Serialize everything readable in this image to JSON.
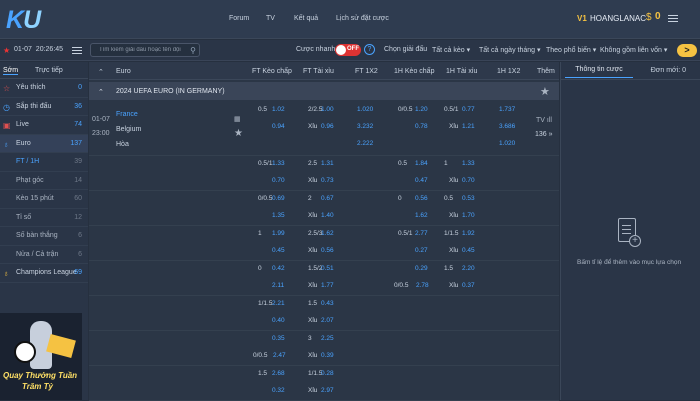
{
  "app": {
    "logo": "KU",
    "logo_colored": "K"
  },
  "topnav": {
    "items": [
      "Forum",
      "TV",
      "Kết quả",
      "Lịch sử đặt cược"
    ],
    "vip": "V1",
    "username": "HOANGLANAC",
    "currency": "$",
    "balance": "0"
  },
  "toolbar": {
    "date": "01-07",
    "time": "20:26:45",
    "search_placeholder": "Tìm kiếm giải đấu hoặc tên đội",
    "quick_bet_label": "Cược nhanh",
    "quick_bet_state": "OFF",
    "select_league": "Chọn giải đấu",
    "all_bet_types": "Tất cả kèo",
    "all_dates": "Tất cả ngày tháng",
    "sort_popular": "Theo phổ biến",
    "no_parlay": "Không gồm liên vốn",
    "more_button": ">"
  },
  "sidebar": {
    "tabs": [
      "Sớm",
      "Trực tiếp"
    ],
    "items": [
      {
        "icon": "star-icon",
        "label": "Yêu thích",
        "count": "0"
      },
      {
        "icon": "clock-icon",
        "label": "Sắp thi đấu",
        "count": "36"
      },
      {
        "icon": "live-icon",
        "label": "Live",
        "count": "74"
      },
      {
        "icon": "trophy-icon",
        "label": "Euro",
        "count": "137"
      },
      {
        "icon": "",
        "label": "FT / 1H",
        "count": "39"
      },
      {
        "icon": "",
        "label": "Phạt góc",
        "count": "14"
      },
      {
        "icon": "",
        "label": "Kèo 15 phút",
        "count": "60"
      },
      {
        "icon": "",
        "label": "Tỉ số",
        "count": "12"
      },
      {
        "icon": "",
        "label": "Số bàn thắng",
        "count": "6"
      },
      {
        "icon": "",
        "label": "Nửa / Cả trận",
        "count": "6"
      },
      {
        "icon": "trophy-icon",
        "label": "Champions League",
        "count": "69"
      }
    ],
    "promo_line1": "Quay Thưởng Tuần",
    "promo_line2": "Trăm Tỷ"
  },
  "table": {
    "headers": [
      "Euro",
      "FT Kèo chấp",
      "FT Tài xỉu",
      "FT 1X2",
      "1H Kèo chấp",
      "1H Tài xỉu",
      "1H 1X2",
      "Thêm"
    ],
    "league": "2024 UEFA EURO (IN GERMANY)",
    "match": {
      "date": "01-07",
      "time": "23:00",
      "home": "France",
      "away": "Belgium",
      "draw": "Hòa",
      "more_count": "136",
      "more_arrow": "»",
      "tv": "TV"
    },
    "rows": [
      {
        "hc": "0.5",
        "hco1": "1.02",
        "hco2": "0.94",
        "ou": "2/2.5",
        "ouo1": "1.00",
        "ouu": "Xỉu",
        "ouo2": "0.96",
        "x1": "1.020",
        "x2": "3.232",
        "x3": "2.222",
        "h_hc": "0/0.5",
        "h_hco1": "1.20",
        "h_hco2": "0.78",
        "h_ou": "0.5/1",
        "h_ouo1": "0.77",
        "h_ouu": "Xỉu",
        "h_ouo2": "1.21",
        "h_x1": "1.737",
        "h_x2": "3.686",
        "h_x3": "1.020"
      },
      {
        "hc": "0.5/1",
        "hco1": "1.33",
        "hco2": "0.70",
        "ou": "2.5",
        "ouo1": "1.31",
        "ouu": "Xỉu",
        "ouo2": "0.73",
        "h_hc": "0.5",
        "h_hco1": "1.84",
        "h_hco2": "0.47",
        "h_ou": "1",
        "h_ouo1": "1.33",
        "h_ouu": "Xỉu",
        "h_ouo2": "0.70"
      },
      {
        "hc": "0/0.5",
        "hco1": "0.69",
        "hco2": "1.35",
        "ou": "2",
        "ouo1": "0.67",
        "ouu": "Xỉu",
        "ouo2": "1.40",
        "h_hc": "0",
        "h_hco1": "0.56",
        "h_hco2": "1.62",
        "h_ou": "0.5",
        "h_ouo1": "0.53",
        "h_ouu": "Xỉu",
        "h_ouo2": "1.70"
      },
      {
        "hc": "1",
        "hco1": "1.99",
        "hco2": "0.45",
        "ou": "2.5/3",
        "ouo1": "1.62",
        "ouu": "Xỉu",
        "ouo2": "0.56",
        "h_hc": "0.5/1",
        "h_hco1": "2.77",
        "h_hco2": "0.27",
        "h_ou": "1/1.5",
        "h_ouo1": "1.92",
        "h_ouu": "Xỉu",
        "h_ouo2": "0.45"
      },
      {
        "hc": "0",
        "hco1": "0.42",
        "hco2": "2.11",
        "ou": "1.5/2",
        "ouo1": "0.51",
        "ouu": "Xỉu",
        "ouo2": "1.77",
        "h_hc": "",
        "h_hco1": "0.29",
        "h_hco2": "0/0.5",
        "h_hco2b": "2.78",
        "h_ou": "1.5",
        "h_ouo1": "2.20",
        "h_ouu": "Xỉu",
        "h_ouo2": "0.37"
      },
      {
        "hc": "1/1.5",
        "hco1": "2.21",
        "hco2": "0.40",
        "ou": "1.5",
        "ouo1": "0.43",
        "ouu": "Xỉu",
        "ouo2": "2.07"
      },
      {
        "hc": "",
        "hco1": "0.35",
        "hco2": "0/0.5",
        "hco2b": "2.47",
        "ou": "3",
        "ouo1": "2.25",
        "ouu": "Xỉu",
        "ouo2": "0.39"
      },
      {
        "hc": "1.5",
        "hco1": "2.68",
        "hco2": "0.32",
        "ou": "1/1.5",
        "ouo1": "0.28",
        "ouu": "Xỉu",
        "ouo2": "2.97"
      }
    ]
  },
  "right_panel": {
    "tab": "Thông tin cược",
    "pending_label": "Đơn mới:",
    "pending_count": "0",
    "message": "Bấm tỉ lệ để thêm vào mục lựa chọn"
  }
}
